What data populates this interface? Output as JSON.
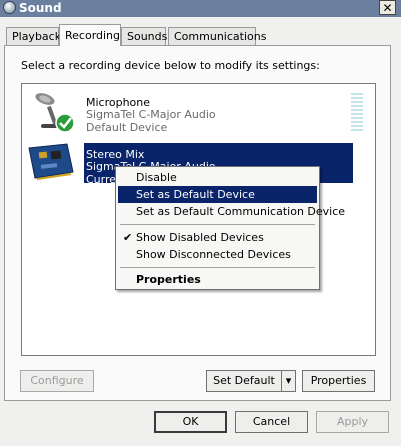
{
  "window": {
    "title": "Sound",
    "close_glyph": "✕"
  },
  "tabs": [
    {
      "label": "Playback"
    },
    {
      "label": "Recording"
    },
    {
      "label": "Sounds"
    },
    {
      "label": "Communications"
    }
  ],
  "instruction": "Select a recording device below to modify its settings:",
  "devices": [
    {
      "name": "Microphone",
      "driver": "SigmaTel C-Major Audio",
      "status": "Default Device",
      "icon": "microphone-icon",
      "badge": "default-check-icon"
    },
    {
      "name": "Stereo Mix",
      "driver": "SigmaTel C-Major Audio",
      "status": "Curren",
      "icon": "sound-card-icon"
    }
  ],
  "context_menu": {
    "items": [
      {
        "label": "Disable"
      },
      {
        "label": "Set as Default Device"
      },
      {
        "label": "Set as Default Communication Device"
      },
      {
        "label": "Show Disabled Devices",
        "checked": true
      },
      {
        "label": "Show Disconnected Devices"
      },
      {
        "label": "Properties"
      }
    ],
    "check_glyph": "✔"
  },
  "panel_buttons": {
    "configure": "Configure",
    "set_default": "Set Default",
    "dropdown_glyph": "▾",
    "properties": "Properties"
  },
  "footer_buttons": {
    "ok": "OK",
    "cancel": "Cancel",
    "apply": "Apply"
  },
  "colors": {
    "titlebar": "#6b7f9e",
    "selection": "#0a246a",
    "check_green": "#2a9d3a"
  }
}
